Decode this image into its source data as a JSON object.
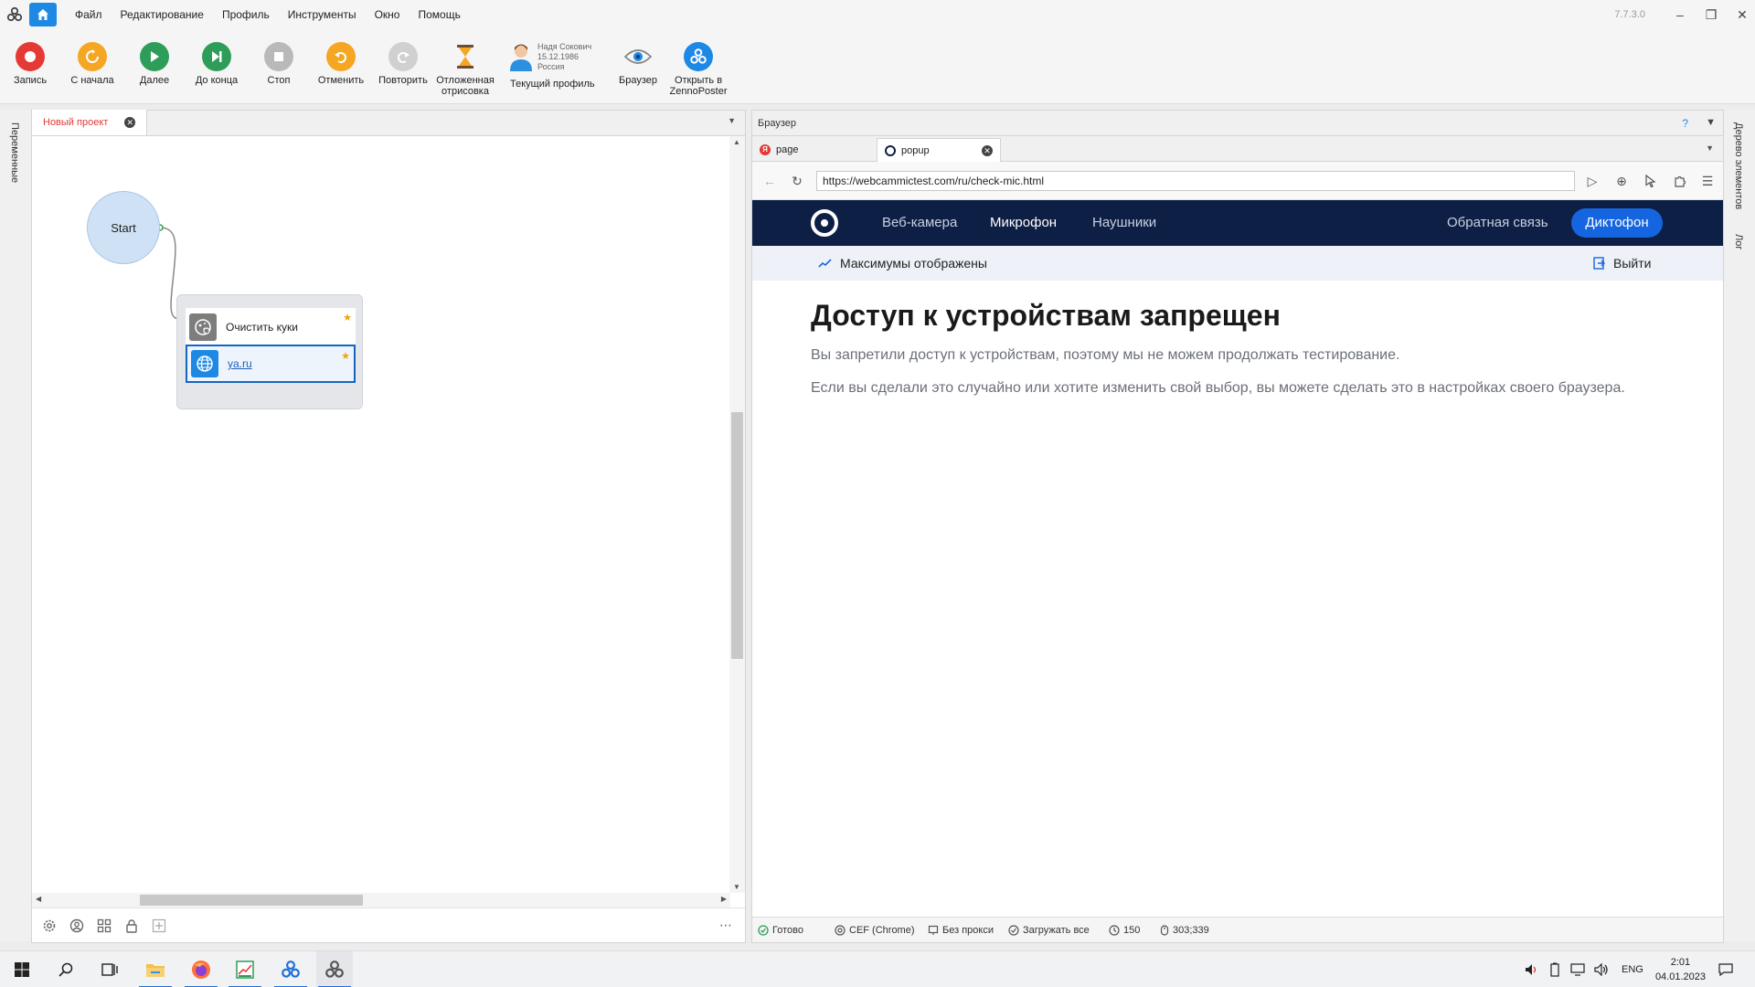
{
  "window": {
    "version": "7.7.3.0",
    "menu": [
      "Файл",
      "Редактирование",
      "Профиль",
      "Инструменты",
      "Окно",
      "Помощь"
    ]
  },
  "toolbar": {
    "record": "Запись",
    "restart": "С начала",
    "next": "Далее",
    "to_end": "До конца",
    "stop": "Стоп",
    "undo": "Отменить",
    "redo": "Повторить",
    "delayed_render_1": "Отложенная",
    "delayed_render_2": "отрисовка",
    "profile_name": "Надя Сокович",
    "profile_date": "15.12.1986",
    "profile_country": "Россия",
    "current_profile": "Текущий профиль",
    "browser": "Браузер",
    "open_in_1": "Открыть в",
    "open_in_2": "ZennoPoster"
  },
  "left_strip": {
    "variables": "Переменные"
  },
  "right_strip": {
    "element_tree": "Дерево элементов",
    "log": "Лог"
  },
  "project": {
    "tab_label": "Новый проект",
    "start_node": "Start",
    "block_clear_cookies": "Очистить куки",
    "block_url": "ya.ru"
  },
  "browser": {
    "panel_title": "Браузер",
    "help": "?",
    "tabs": [
      {
        "label": "page"
      },
      {
        "label": "popup"
      }
    ],
    "url": "https://webcammictest.com/ru/check-mic.html"
  },
  "site": {
    "nav": {
      "webcam": "Веб-камера",
      "mic": "Микрофон",
      "headphones": "Наушники",
      "feedback": "Обратная связь",
      "dictaphone": "Диктофон"
    },
    "sub_left": "Максимумы отображены",
    "sub_right": "Выйти",
    "heading": "Доступ к устройствам запрещен",
    "p1": "Вы запретили доступ к устройствам, поэтому мы не можем продолжать тестирование.",
    "p2": "Если вы сделали это случайно или хотите изменить свой выбор, вы можете сделать это в настройках своего браузера."
  },
  "status": {
    "ready": "Готово",
    "engine": "CEF (Chrome)",
    "proxy": "Без прокси",
    "load": "Загружать все",
    "timer": "150",
    "coords": "303;339"
  },
  "taskbar": {
    "lang": "ENG",
    "time": "2:01",
    "date": "04.01.2023"
  },
  "colors": {
    "accent": "#1e88e5",
    "site_nav": "#0e1f45",
    "site_button": "#1565e0",
    "record": "#e53935",
    "green": "#2e9d5a",
    "orange": "#f5a623"
  }
}
